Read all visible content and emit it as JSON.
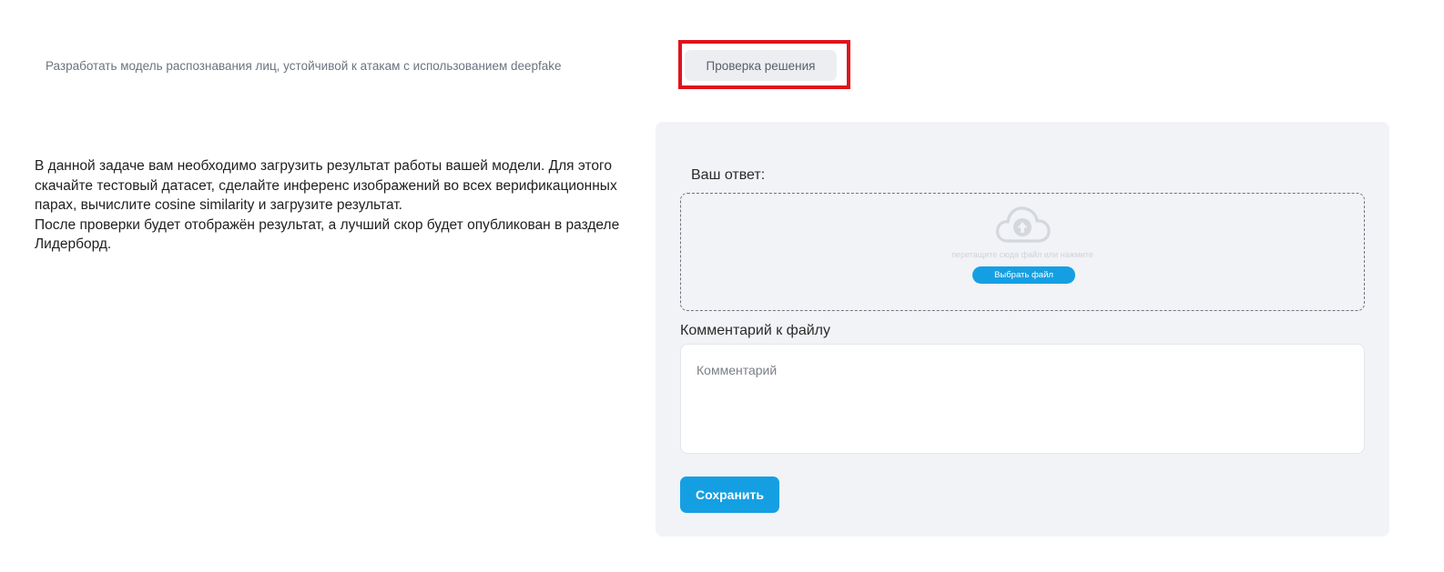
{
  "breadcrumb": {
    "task_link": "Разработать модель распознавания лиц, устойчивой к атакам с использованием deepfake",
    "current": "Проверка решения"
  },
  "description": {
    "paragraph_1": "В данной задаче вам необходимо загрузить результат работы вашей модели. Для этого скачайте тестовый датасет, сделайте инференс изображений во всех верификационных парах, вычислите cosine similarity и загрузите результат.",
    "paragraph_2": "После проверки будет отображён результат, а лучший скор будет опубликован в разделе Лидерборд."
  },
  "form": {
    "answer_label": "Ваш ответ:",
    "dropzone_hint": "перетащите сюда файл или нажмите",
    "choose_file_label": "Выбрать файл",
    "upload_icon": "cloud-upload-icon",
    "comment_label": "Комментарий к файлу",
    "comment_placeholder": "Комментарий",
    "comment_value": "",
    "save_label": "Сохранить"
  },
  "colors": {
    "accent": "#159fe3",
    "highlight": "#e0131c",
    "panel_background": "#f1f3f6"
  }
}
